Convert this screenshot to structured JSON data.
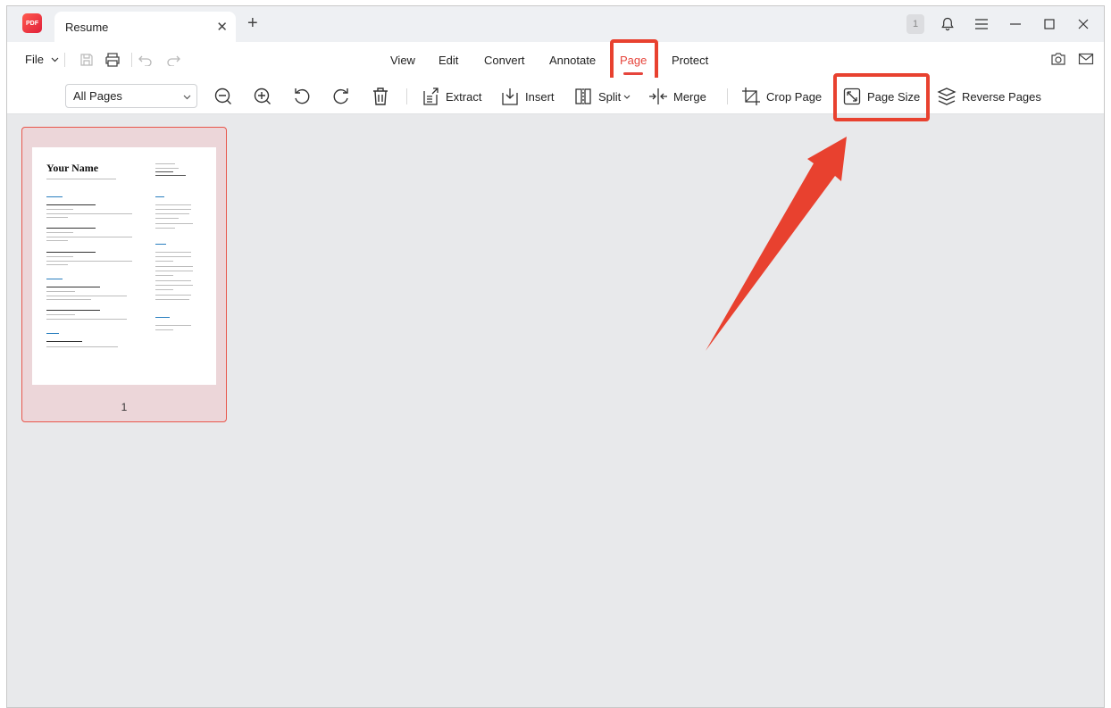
{
  "app": {
    "logo_text": "PDF",
    "tab_title": "Resume",
    "notification_count": "1"
  },
  "menubar": {
    "file_label": "File",
    "items": [
      {
        "id": "view",
        "label": "View"
      },
      {
        "id": "edit",
        "label": "Edit"
      },
      {
        "id": "convert",
        "label": "Convert"
      },
      {
        "id": "annotate",
        "label": "Annotate"
      },
      {
        "id": "page",
        "label": "Page",
        "active": true
      },
      {
        "id": "protect",
        "label": "Protect"
      }
    ]
  },
  "toolbar": {
    "page_range": "All Pages",
    "extract": "Extract",
    "insert": "Insert",
    "split": "Split",
    "merge": "Merge",
    "crop_page": "Crop Page",
    "page_size": "Page Size",
    "reverse_pages": "Reverse Pages"
  },
  "thumbnail": {
    "page_number": "1",
    "resume_name": "Your Name"
  },
  "colors": {
    "accent": "#e6453c",
    "highlight_box": "#e8412f",
    "thumb_selected_bg": "#ecd6d9"
  }
}
